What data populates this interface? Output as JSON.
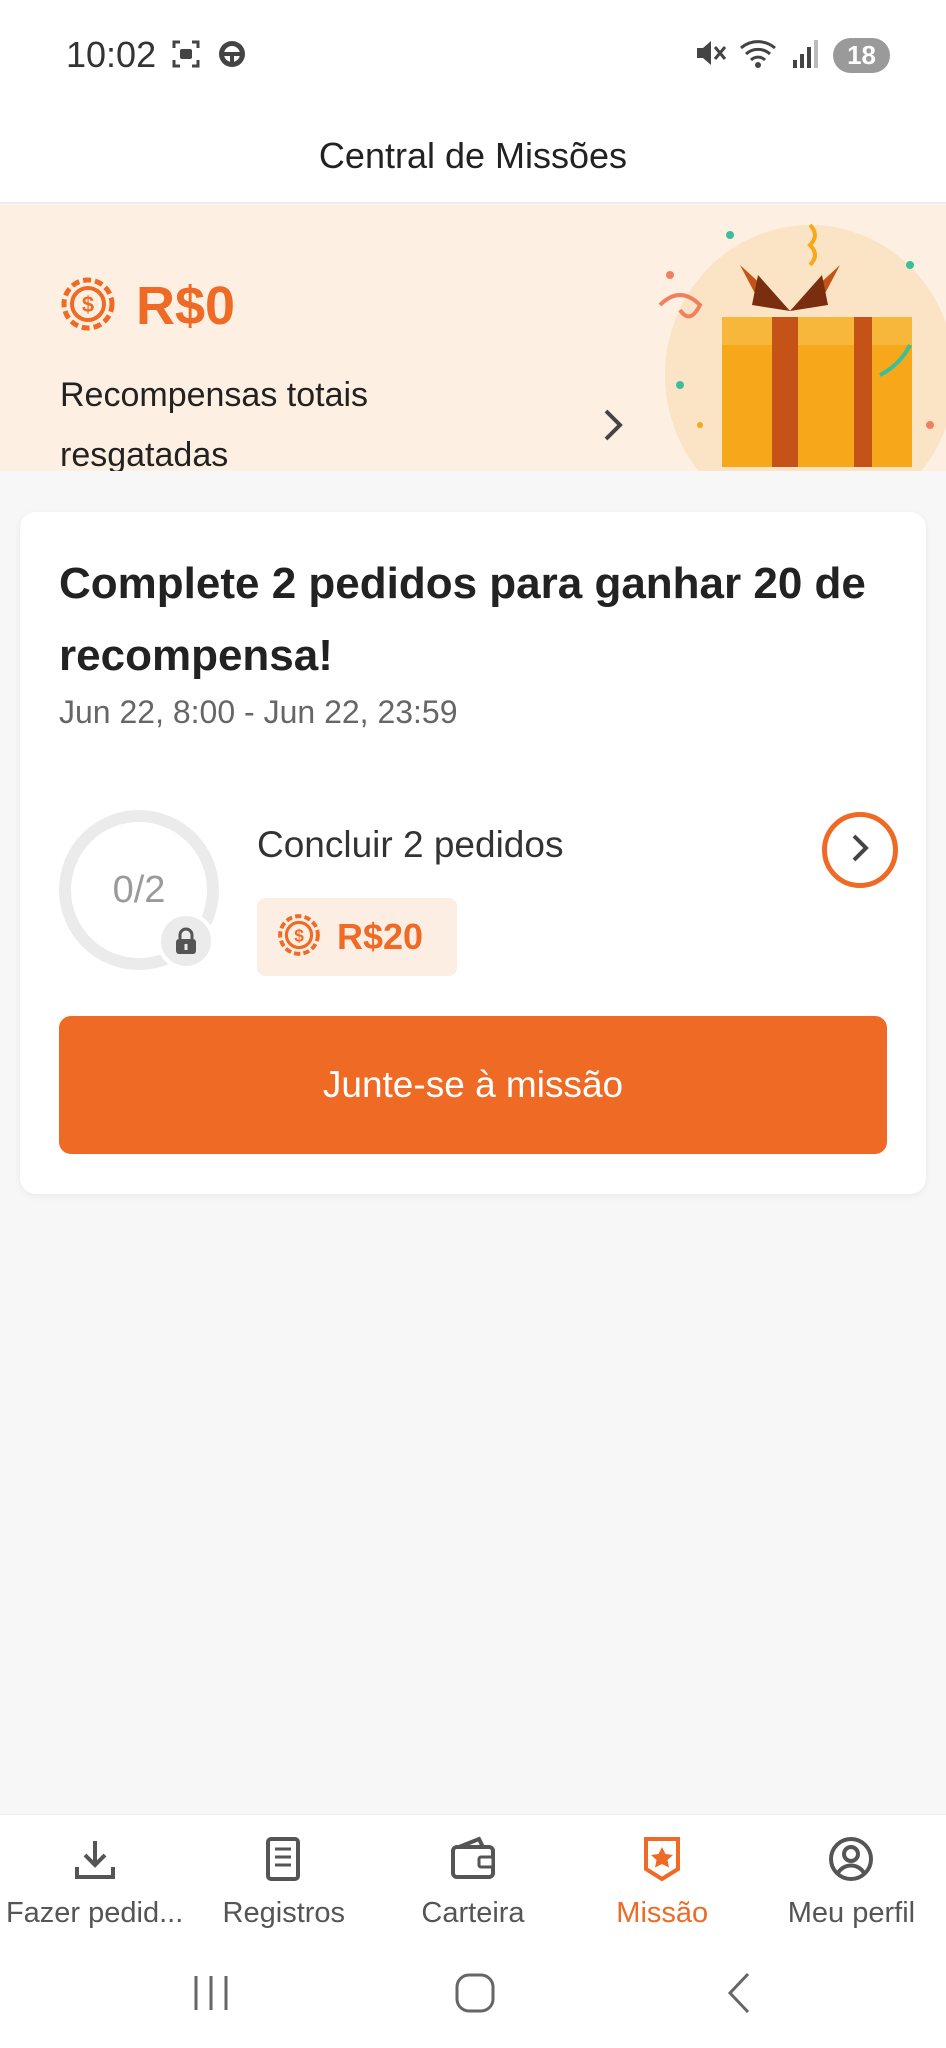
{
  "status_bar": {
    "time": "10:02",
    "battery": "18",
    "icons": [
      "screenshot-icon",
      "steering-wheel-icon",
      "mute-icon",
      "wifi-icon",
      "signal-icon"
    ]
  },
  "header": {
    "title": "Central de Missões"
  },
  "banner": {
    "amount": "R$0",
    "caption": "Recompensas totais resgatadas",
    "icon": "coin-icon"
  },
  "mission": {
    "title": "Complete 2 pedidos para ganhar 20 de recompensa!",
    "dates": "Jun 22, 8:00 - Jun 22, 23:59",
    "progress": "0/2",
    "task_label": "Concluir 2 pedidos",
    "reward": "R$20",
    "join_label": "Junte-se à missão"
  },
  "bottom_nav": {
    "items": [
      {
        "label": "Fazer pedid...",
        "icon": "download-icon",
        "active": false
      },
      {
        "label": "Registros",
        "icon": "document-icon",
        "active": false
      },
      {
        "label": "Carteira",
        "icon": "wallet-icon",
        "active": false
      },
      {
        "label": "Missão",
        "icon": "star-badge-icon",
        "active": true
      },
      {
        "label": "Meu perfil",
        "icon": "user-icon",
        "active": false
      }
    ]
  },
  "colors": {
    "accent": "#ee6a25",
    "banner_bg": "#fdf0e2",
    "page_bg": "#f7f7f7"
  }
}
